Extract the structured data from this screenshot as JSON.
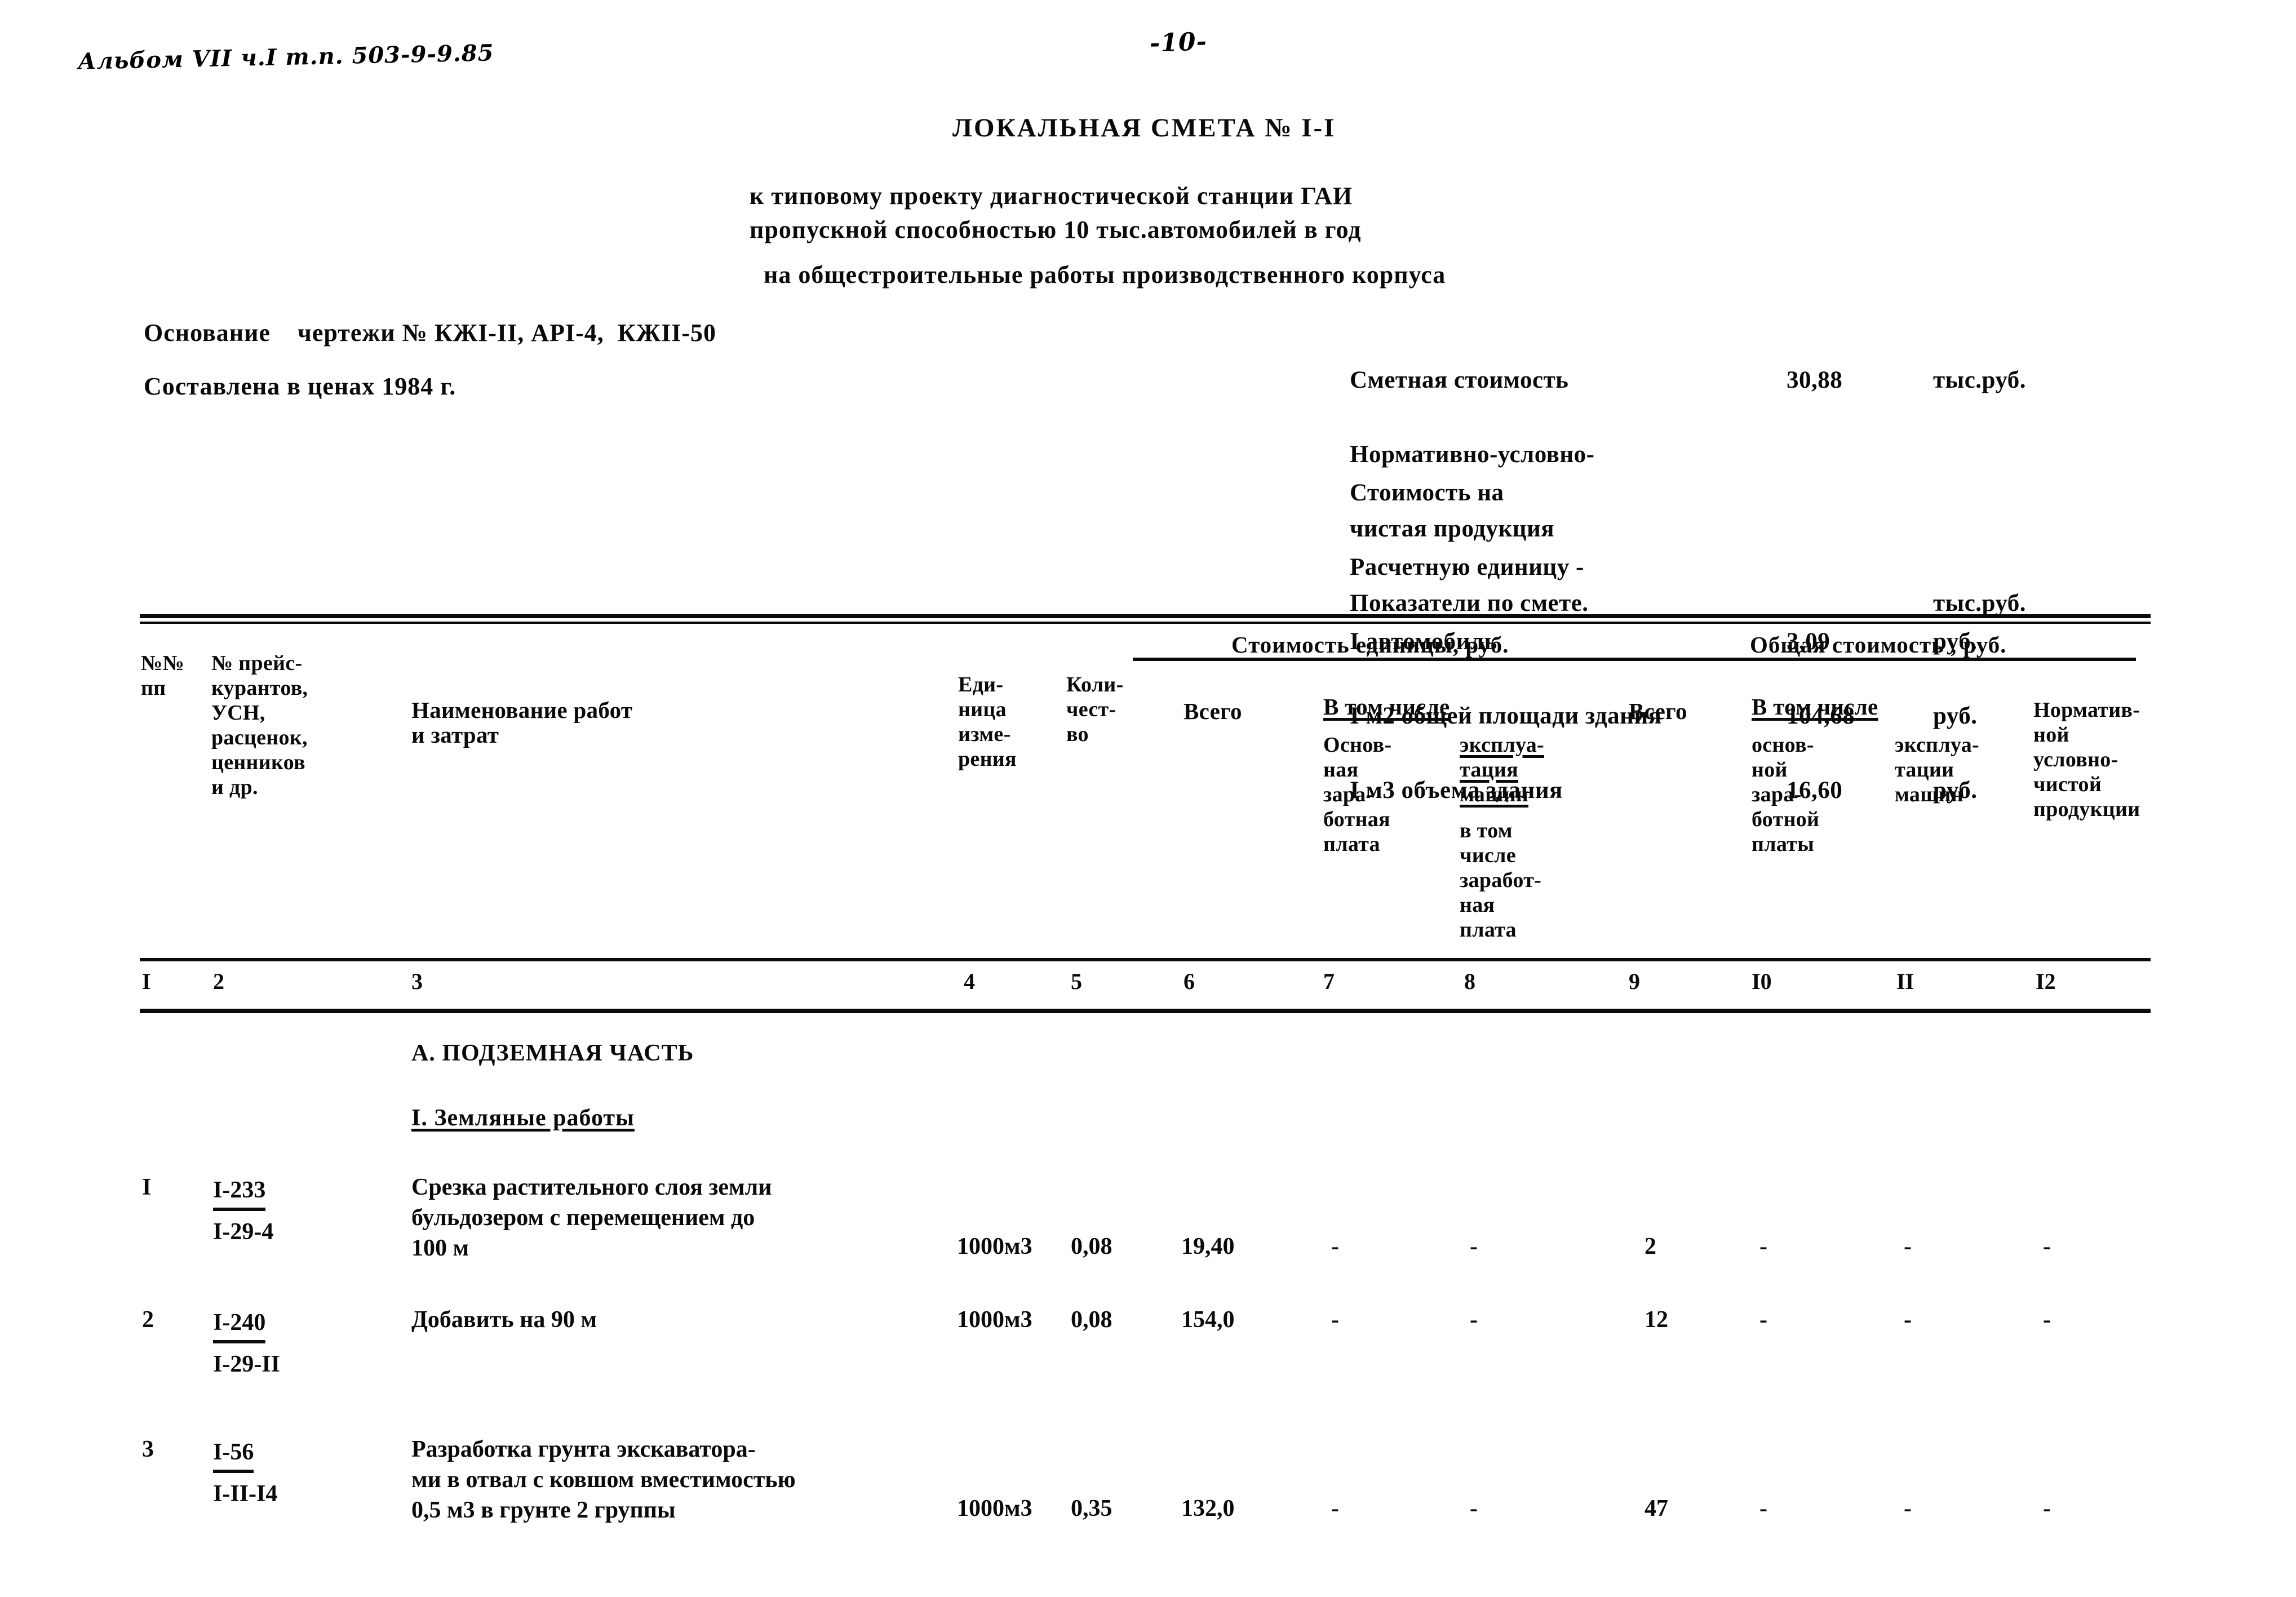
{
  "annotations": {
    "album_note": "Альбом VII ч.I   т.п. 503-9-9.85",
    "page_number": "-10-"
  },
  "header": {
    "title": "ЛОКАЛЬНАЯ СМЕТА № I-I",
    "subtitle_line1": "к типовому проекту диагностической станции ГАИ",
    "subtitle_line2": "пропускной способностью 10 тыс.автомобилей в год",
    "subtitle_line3": "на общестроительные работы производственного корпуса",
    "basis_label": "Основание",
    "basis_value": "чертежи № КЖI-II, АРI-4,  КЖII-50",
    "prices_line": "Составлена в ценах 1984 г."
  },
  "summary": {
    "rows": [
      {
        "label": "Сметная стоимость",
        "value": "30,88",
        "unit": "тыс.руб."
      },
      {
        "label": "Нормативно-условно-",
        "value": "",
        "unit": ""
      },
      {
        "label": "чистая продукция",
        "value": "",
        "unit": ""
      },
      {
        "label": "Показатели по смете.",
        "value": "",
        "unit": "тыс.руб."
      }
    ],
    "unit_rows": [
      {
        "label": "Стоимость на",
        "value": "",
        "unit": ""
      },
      {
        "label": "Расчетную единицу -",
        "value": "",
        "unit": ""
      },
      {
        "label": "I автомобиль",
        "value": "3,09",
        "unit": "руб."
      },
      {
        "label": "I м2 общей площади здания",
        "value": "104,68",
        "unit": "руб."
      },
      {
        "label": "I м3 объема здания",
        "value": "16,60",
        "unit": "руб."
      }
    ]
  },
  "table": {
    "group_unit_cost": "Стоимость единицы, руб.",
    "group_total_cost": "Общая стоимость , руб.",
    "headers": {
      "c1": "№№\nпп",
      "c2": "№ прейс-\nкурантов,\nУСН,\nрасценок,\nценников\nи др.",
      "c3": "Наименование работ\nи затрат",
      "c4": "Еди-\nница\nизме-\nрения",
      "c5": "Коли-\nчест-\nво",
      "c6": "Всего",
      "c7_group": "В том числе",
      "c7": "Основ-\nная\nзара-\nботная\nплата",
      "c8a": "эксплуа-\nтация\nмашин",
      "c8b": "в том\nчисле\nзаработ-\nная\nплата",
      "c9": "Всего",
      "c10_group": "В том числе",
      "c10": "основ-\nной\nзара-\nботной\nплаты",
      "c11": "эксплуа-\nтации\nмашин",
      "c12": "Норматив-\nной\nусловно-\nчистой\nпродукции"
    },
    "column_numbers": [
      "I",
      "2",
      "3",
      "4",
      "5",
      "6",
      "7",
      "8",
      "9",
      "I0",
      "II",
      "I2"
    ],
    "sections": [
      {
        "id": "A",
        "label": "А. ПОДЗЕМНАЯ ЧАСТЬ",
        "underlined": false
      },
      {
        "id": "A1",
        "label": "I. Земляные работы",
        "underlined": true
      }
    ],
    "rows": [
      {
        "no": "I",
        "code_num": "I-233",
        "code_den": "I-29-4",
        "description": "Срезка растительного слоя земли\nбульдозером с перемещением до\n100 м",
        "unit": "1000м3",
        "qty": "0,08",
        "unit_total": "19,40",
        "unit_wage": "-",
        "unit_machine": "-",
        "total": "2",
        "total_wage": "-",
        "total_machine": "-",
        "nucp": "-"
      },
      {
        "no": "2",
        "code_num": "I-240",
        "code_den": "I-29-II",
        "description": "Добавить на 90 м",
        "unit": "1000м3",
        "qty": "0,08",
        "unit_total": "154,0",
        "unit_wage": "-",
        "unit_machine": "-",
        "total": "12",
        "total_wage": "-",
        "total_machine": "-",
        "nucp": "-"
      },
      {
        "no": "3",
        "code_num": "I-56",
        "code_den": "I-II-I4",
        "description": "Разработка грунта экскаватора-\nми в отвал с ковшом вместимостью\n0,5 м3 в грунте 2 группы",
        "unit": "1000м3",
        "qty": "0,35",
        "unit_total": "132,0",
        "unit_wage": "-",
        "unit_machine": "-",
        "total": "47",
        "total_wage": "-",
        "total_machine": "-",
        "nucp": "-"
      }
    ]
  }
}
